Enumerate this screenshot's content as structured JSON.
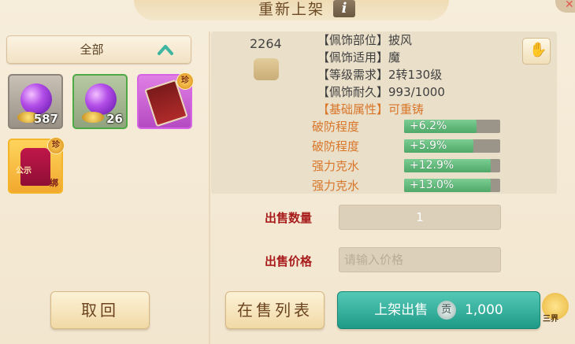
{
  "window": {
    "title": "重新上架",
    "info_label": "i"
  },
  "category": {
    "label": "全部"
  },
  "inventory": [
    {
      "name": "purple-orb",
      "count": "587"
    },
    {
      "name": "purple-orb-2",
      "count": "26"
    },
    {
      "name": "red-scroll",
      "badge": "珍"
    },
    {
      "name": "red-robe",
      "badge": "珍",
      "tag": "公示",
      "bind": "绑"
    }
  ],
  "item": {
    "number": "2264",
    "attributes": [
      {
        "key": "【佩饰部位】",
        "value": "披风"
      },
      {
        "key": "【佩饰适用】",
        "value": "魔"
      },
      {
        "key": "【等级需求】",
        "value": "2转130级"
      },
      {
        "key": "【佩饰耐久】",
        "value": "993/1000"
      },
      {
        "key": "【基础属性】",
        "value": "可重铸"
      }
    ],
    "stats": [
      {
        "name": "破防程度",
        "value": "+6.2%",
        "fill": 0.75
      },
      {
        "name": "破防程度",
        "value": "+5.9%",
        "fill": 0.72
      },
      {
        "name": "强力克水",
        "value": "+12.9%",
        "fill": 0.9
      },
      {
        "name": "强力克水",
        "value": "+13.0%",
        "fill": 0.9
      }
    ]
  },
  "sell": {
    "quantity_label": "出售数量",
    "quantity_value": "1",
    "price_label": "出售价格",
    "price_placeholder": "请输入价格"
  },
  "buttons": {
    "cancel": "取回",
    "list": "在售列表",
    "sell_label": "上架出售",
    "sell_coin": "贡",
    "sell_amount": "1,000",
    "realm": "三界"
  },
  "colors": {
    "accent": "#d8762a",
    "sell_button": "#2aa995",
    "label_red": "#a81c1c"
  }
}
